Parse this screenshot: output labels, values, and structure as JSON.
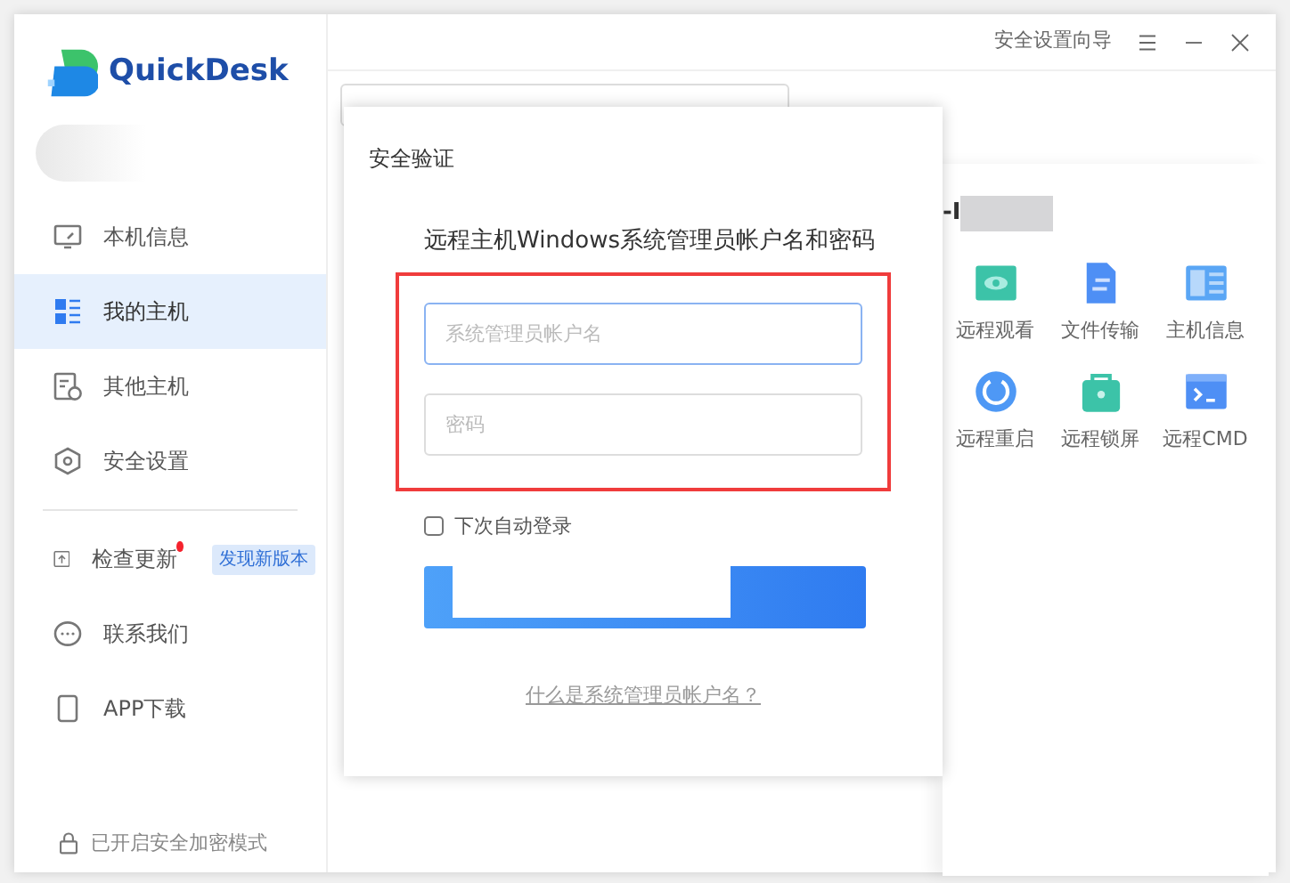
{
  "app": {
    "logo_text": "QuickDesk"
  },
  "sidebar": {
    "items": [
      {
        "kind": "monitor",
        "label": "本机信息",
        "selected": false
      },
      {
        "kind": "hosts",
        "label": "我的主机",
        "selected": true
      },
      {
        "kind": "clock",
        "label": "其他主机",
        "selected": false
      },
      {
        "kind": "shield",
        "label": "安全设置",
        "selected": false
      }
    ],
    "extra_items": [
      {
        "kind": "upload",
        "label": "检查更新",
        "notification": true,
        "badge": "发现新版本"
      },
      {
        "kind": "chat",
        "label": "联系我们",
        "notification": false
      },
      {
        "kind": "phone",
        "label": "APP下载",
        "notification": false
      }
    ],
    "footer": "已开启安全加密模式"
  },
  "top_bar": {
    "guide_link": "安全设置向导"
  },
  "host_panel": {
    "name": "-I",
    "actions": [
      {
        "kind": "eye",
        "label": "远程观看"
      },
      {
        "kind": "file",
        "label": "文件传输"
      },
      {
        "kind": "info",
        "label": "主机信息"
      },
      {
        "kind": "restart",
        "label": "远程重启"
      },
      {
        "kind": "lock",
        "label": "远程锁屏"
      },
      {
        "kind": "cmd",
        "label": "远程CMD"
      }
    ]
  },
  "dialog": {
    "title": "安全验证",
    "heading": "远程主机Windows系统管理员帐户名和密码",
    "fields": [
      {
        "placeholder": "系统管理员帐户名",
        "focused": true
      },
      {
        "placeholder": "密码",
        "focused": false
      }
    ],
    "auto_login": {
      "label": "下次自动登录",
      "checked": false
    },
    "help_link": "什么是系统管理员帐户名？"
  }
}
